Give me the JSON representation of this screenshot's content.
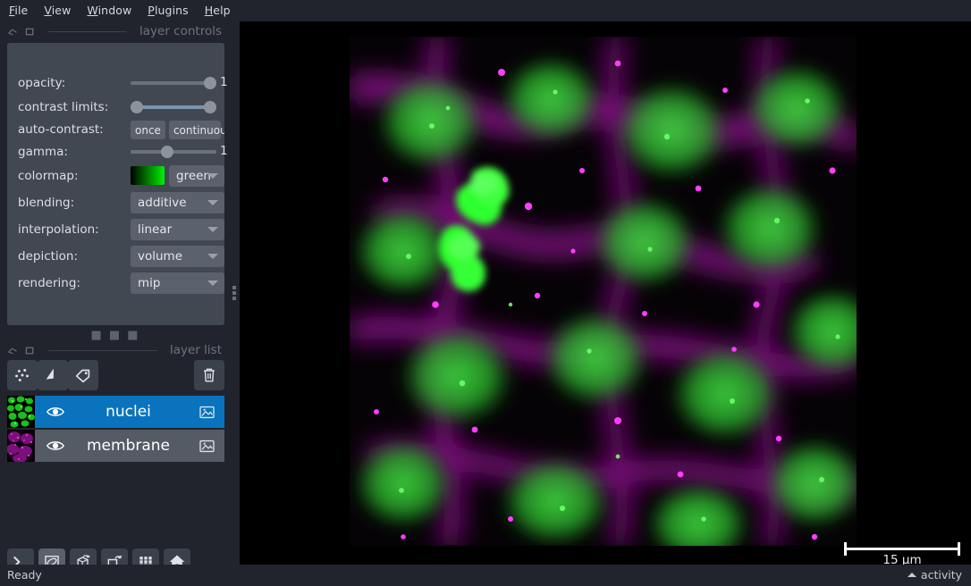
{
  "menubar": {
    "items": [
      {
        "mnemonic": "F",
        "rest": "ile"
      },
      {
        "mnemonic": "V",
        "rest": "iew"
      },
      {
        "mnemonic": "W",
        "rest": "indow"
      },
      {
        "mnemonic": "P",
        "rest": "lugins"
      },
      {
        "mnemonic": "H",
        "rest": "elp"
      }
    ]
  },
  "layer_controls": {
    "dock_title": "layer controls",
    "opacity": {
      "label": "opacity:",
      "value": "1.0",
      "fraction": 1.0
    },
    "contrast_limits": {
      "label": "contrast limits:",
      "low_fraction": 0.0,
      "high_fraction": 1.0
    },
    "auto_contrast": {
      "label": "auto-contrast:",
      "once": "once",
      "continuous": "continuous"
    },
    "gamma": {
      "label": "gamma:",
      "value": "1.0",
      "fraction": 0.5
    },
    "colormap": {
      "label": "colormap:",
      "value": "green"
    },
    "blending": {
      "label": "blending:",
      "value": "additive"
    },
    "interpolation": {
      "label": "interpolation:",
      "value": "linear"
    },
    "depiction": {
      "label": "depiction:",
      "value": "volume"
    },
    "rendering": {
      "label": "rendering:",
      "value": "mip"
    }
  },
  "layer_list": {
    "dock_title": "layer list",
    "new_buttons": [
      {
        "name": "new-points-layer",
        "tooltip": "New points layer"
      },
      {
        "name": "new-shapes-layer",
        "tooltip": "New shapes layer"
      },
      {
        "name": "new-labels-layer",
        "tooltip": "New labels layer"
      }
    ],
    "delete_button": "delete",
    "layers": [
      {
        "name": "nuclei",
        "selected": true,
        "visible": true,
        "type": "image",
        "colormap": "green"
      },
      {
        "name": "membrane",
        "selected": false,
        "visible": true,
        "type": "image",
        "colormap": "magenta"
      }
    ]
  },
  "viewer_buttons": [
    {
      "name": "console-button",
      "label": "Console",
      "active": false
    },
    {
      "name": "ndisplay-button",
      "label": "Toggle 2D/3D",
      "active": true
    },
    {
      "name": "roll-dims-button",
      "label": "Roll dimensions",
      "active": false
    },
    {
      "name": "transpose-dims-button",
      "label": "Transpose dimensions",
      "active": false
    },
    {
      "name": "grid-view-button",
      "label": "Grid view",
      "active": false
    },
    {
      "name": "home-button",
      "label": "Reset view",
      "active": false
    }
  ],
  "canvas": {
    "scalebar": {
      "length_text": "15 µm"
    }
  },
  "statusbar": {
    "status": "Ready",
    "activity": "activity"
  },
  "colors": {
    "window_bg": "#21242c",
    "panel_bg": "#414851",
    "widget_bg": "#5a616c",
    "selection_blue": "#0a73bd",
    "text": "#dcdee2",
    "muted_text": "#6d727c",
    "nuclei_green": "#00ef00",
    "membrane_magenta": "#d400d4"
  }
}
